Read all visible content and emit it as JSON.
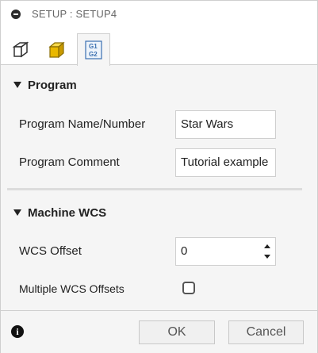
{
  "titlebar": {
    "title": "SETUP : SETUP4",
    "icon": "collapse-icon"
  },
  "tabs": [
    {
      "name": "setup-tab",
      "icon": "setup-cube-icon"
    },
    {
      "name": "stock-tab",
      "icon": "stock-box-icon"
    },
    {
      "name": "post-process-tab",
      "icon": "g1-g2-icon",
      "glyph_top": "G1",
      "glyph_bottom": "G2",
      "active": true
    }
  ],
  "program": {
    "header": "Program",
    "name_label": "Program Name/Number",
    "name_value": "Star Wars",
    "comment_label": "Program Comment",
    "comment_value": "Tutorial example"
  },
  "machine_wcs": {
    "header": "Machine WCS",
    "offset_label": "WCS Offset",
    "offset_value": "0",
    "multiple_label": "Multiple WCS Offsets",
    "multiple_checked": false
  },
  "footer": {
    "info_glyph": "i",
    "ok_label": "OK",
    "cancel_label": "Cancel"
  }
}
